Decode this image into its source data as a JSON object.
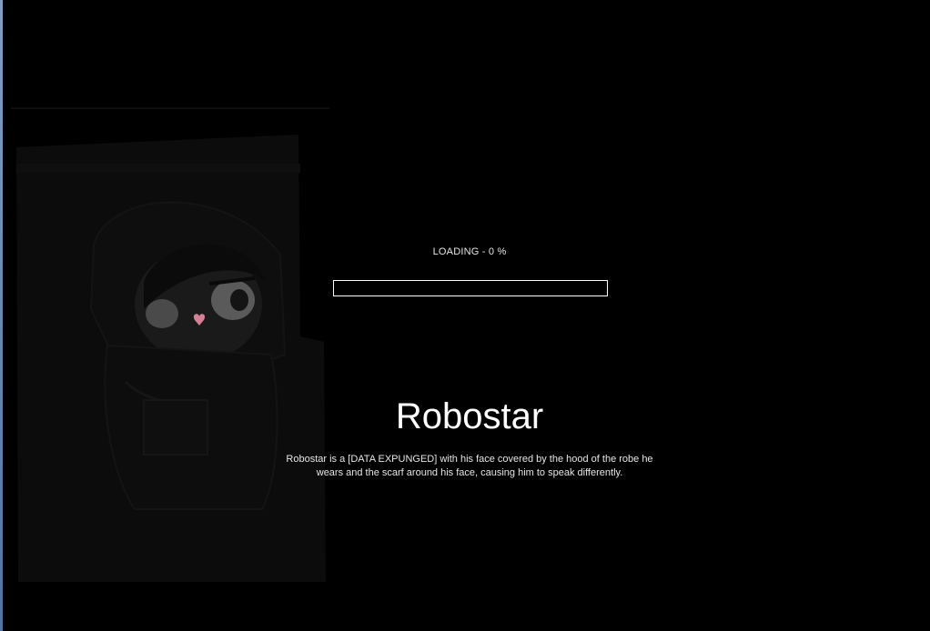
{
  "loading": {
    "label": "LOADING - 0 %",
    "progress_percent": 0
  },
  "character": {
    "name": "Robostar",
    "description": "Robostar is a [DATA EXPUNGED] with his face covered by the hood of the robe he wears and the scarf around his face, causing him to speak differently."
  },
  "icons": {
    "character_portrait": "hooded-character-icon"
  },
  "colors": {
    "background": "#000000",
    "text": "#ffffff",
    "bar_border": "#ffffff",
    "blush": "#d77f97"
  }
}
